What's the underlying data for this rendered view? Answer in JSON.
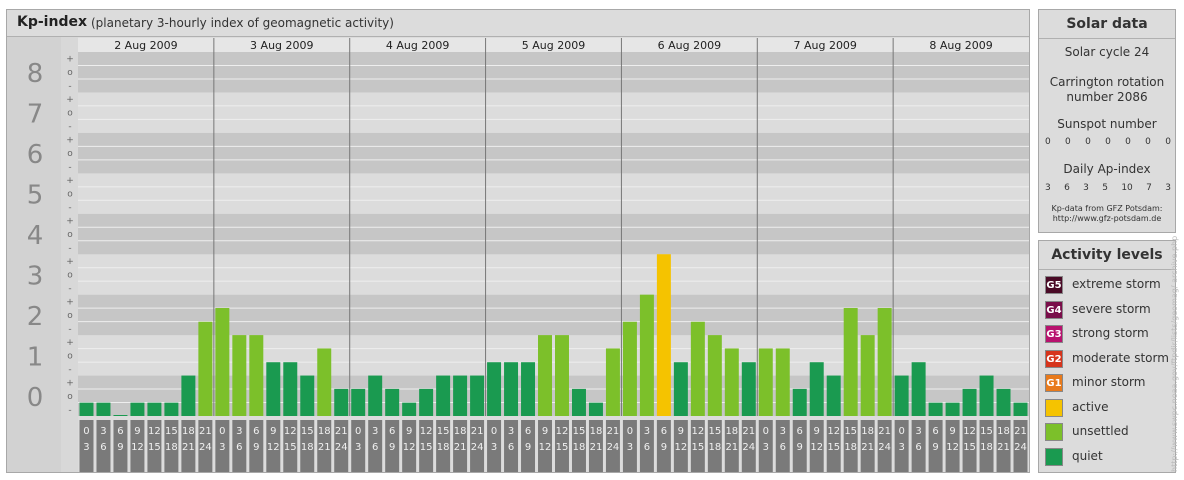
{
  "title": {
    "main": "Kp-index",
    "subtitle": "(planetary 3-hourly index of geomagnetic activity)"
  },
  "solar": {
    "heading": "Solar data",
    "cycle": "Solar cycle 24",
    "rotation_line1": "Carrington rotation",
    "rotation_line2": "number 2086",
    "sunspot_label": "Sunspot number",
    "sunspot_values": [
      "0",
      "0",
      "0",
      "0",
      "0",
      "0",
      "0"
    ],
    "ap_label": "Daily Ap-index",
    "ap_values": [
      "3",
      "6",
      "3",
      "5",
      "10",
      "7",
      "3"
    ],
    "source_line1": "Kp-data from GFZ Potsdam:",
    "source_line2": "http://www.gfz-potsdam.de"
  },
  "levels": {
    "heading": "Activity levels",
    "items": [
      {
        "badge": "G5",
        "label": "extreme storm",
        "color": "#4a0a26"
      },
      {
        "badge": "G4",
        "label": "severe storm",
        "color": "#7a0e4a"
      },
      {
        "badge": "G3",
        "label": "strong storm",
        "color": "#b8126e"
      },
      {
        "badge": "G2",
        "label": "moderate storm",
        "color": "#d6341c"
      },
      {
        "badge": "G1",
        "label": "minor storm",
        "color": "#e87a1c"
      },
      {
        "badge": "",
        "label": "active",
        "color": "#f5c300"
      },
      {
        "badge": "",
        "label": "unsettled",
        "color": "#7cc02a"
      },
      {
        "badge": "",
        "label": "quiet",
        "color": "#1a9a50"
      }
    ]
  },
  "credit": "http://www.swpc.noaa.gov/ftpdir/lists/geomag/ archive.php",
  "chart_data": {
    "type": "bar",
    "ylim": [
      0,
      9
    ],
    "y_ticks": [
      "0",
      "1",
      "2",
      "3",
      "4",
      "5",
      "6",
      "7",
      "8",
      "9"
    ],
    "minor_labels": [
      "+",
      "o",
      "-"
    ],
    "days": [
      "2 Aug 2009",
      "3 Aug 2009",
      "4 Aug 2009",
      "5 Aug 2009",
      "6 Aug 2009",
      "7 Aug 2009",
      "8 Aug 2009"
    ],
    "interval_top": [
      "0",
      "3",
      "6",
      "9",
      "12",
      "15",
      "18",
      "21"
    ],
    "interval_bottom": [
      "3",
      "6",
      "9",
      "12",
      "15",
      "18",
      "21",
      "24"
    ],
    "values": [
      [
        0.33,
        0.33,
        0.0,
        0.33,
        0.33,
        0.33,
        1.0,
        2.33
      ],
      [
        2.67,
        2.0,
        2.0,
        1.33,
        1.33,
        1.0,
        1.67,
        0.67
      ],
      [
        0.67,
        1.0,
        0.67,
        0.33,
        0.67,
        1.0,
        1.0,
        1.0
      ],
      [
        1.33,
        1.33,
        1.33,
        2.0,
        2.0,
        0.67,
        0.33,
        1.67
      ],
      [
        2.33,
        3.0,
        4.0,
        1.33,
        2.33,
        2.0,
        1.67,
        1.33
      ],
      [
        1.67,
        1.67,
        0.67,
        1.33,
        1.0,
        2.67,
        2.0,
        2.67
      ],
      [
        1.0,
        1.33,
        0.33,
        0.33,
        0.67,
        1.0,
        0.67,
        0.33
      ]
    ],
    "colors": {
      "quiet": "#1a9a50",
      "unsettled": "#7cc02a",
      "active": "#f5c300"
    }
  }
}
